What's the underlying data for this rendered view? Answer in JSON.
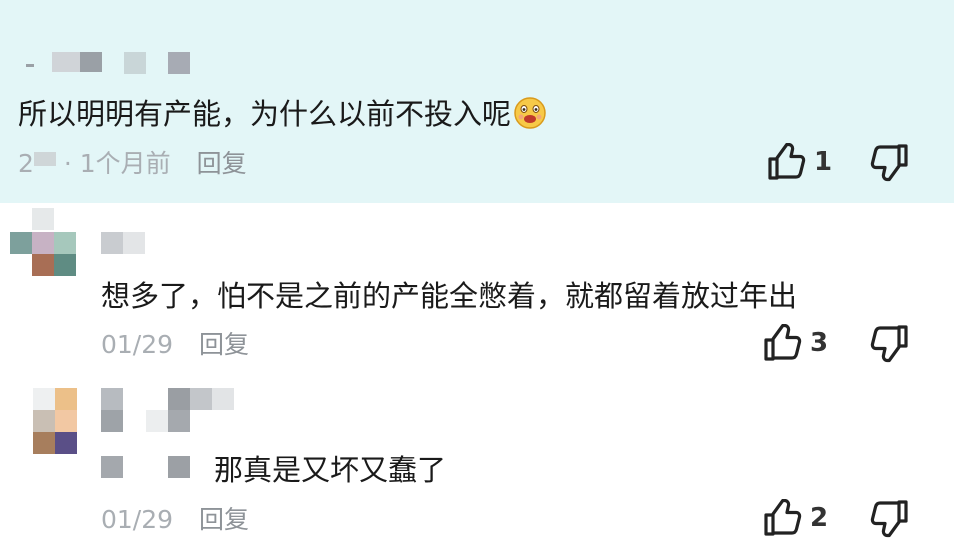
{
  "comments": [
    {
      "text": "所以明明有产能，为什么以前不投入呢",
      "author_prefix": "2",
      "time": "· 1个月前",
      "reply": "回复",
      "likes": "1",
      "emoji": "grimacing-face-emoji"
    },
    {
      "text": "想多了，怕不是之前的产能全憋着，就都留着放过年出",
      "time": "01/29",
      "reply": "回复",
      "likes": "3"
    },
    {
      "text": "那真是又坏又蠢了",
      "time": "01/29",
      "reply": "回复",
      "likes": "2"
    }
  ],
  "colors": {
    "highlight_bg": "#e3f6f7",
    "meta_text": "#a9aeb3",
    "main_text": "#1a1a1a"
  },
  "icons": [
    "thumbs-up-icon",
    "thumbs-down-icon"
  ]
}
